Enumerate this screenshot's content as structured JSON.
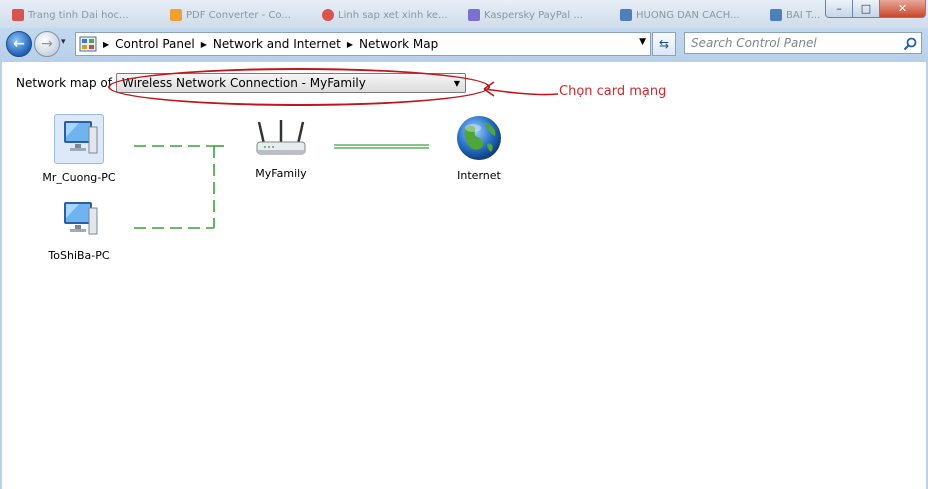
{
  "taskbar_tabs": [
    {
      "label": "Trang tinh Dai hoc...",
      "color": "#d9534f"
    },
    {
      "label": "PDF Converter - Co...",
      "color": "#f0a030"
    },
    {
      "label": "Linh sap xet xinh ke...",
      "color": "#d9534f"
    },
    {
      "label": "Kaspersky PayPal ...",
      "color": "#7c6fd0"
    },
    {
      "label": "HUONG DAN CACH...",
      "color": "#4d7fb8"
    },
    {
      "label": "BAI T...",
      "color": "#4d7fb8"
    }
  ],
  "window_controls": {
    "minimize": "–",
    "maximize": "□",
    "close": "✕"
  },
  "nav": {
    "back": "←",
    "forward": "→",
    "history_dropdown": "▾",
    "refresh": "⇆"
  },
  "breadcrumb": [
    {
      "label": "Control Panel"
    },
    {
      "label": "Network and Internet"
    },
    {
      "label": "Network Map"
    }
  ],
  "address_dropdown": "▼",
  "search": {
    "placeholder": "Search Control Panel",
    "icon": "search-icon"
  },
  "network_map": {
    "label": "Network map of",
    "selected_connection": "Wireless Network Connection - MyFamily",
    "dropdown_arrow": "▼"
  },
  "annotation": {
    "text": "Chọn card mạng",
    "color": "#d1272c"
  },
  "nodes": [
    {
      "id": "computer-1",
      "label": "Mr_Cuong-PC",
      "icon": "computer-icon"
    },
    {
      "id": "computer-2",
      "label": "ToShiBa-PC",
      "icon": "computer-icon"
    },
    {
      "id": "router",
      "label": "MyFamily",
      "icon": "router-icon"
    },
    {
      "id": "internet",
      "label": "Internet",
      "icon": "globe-icon"
    }
  ],
  "colors": {
    "wireless_link": "#3aa33a",
    "wired_link": "#3aa33a",
    "accent": "#1f5fb5"
  }
}
